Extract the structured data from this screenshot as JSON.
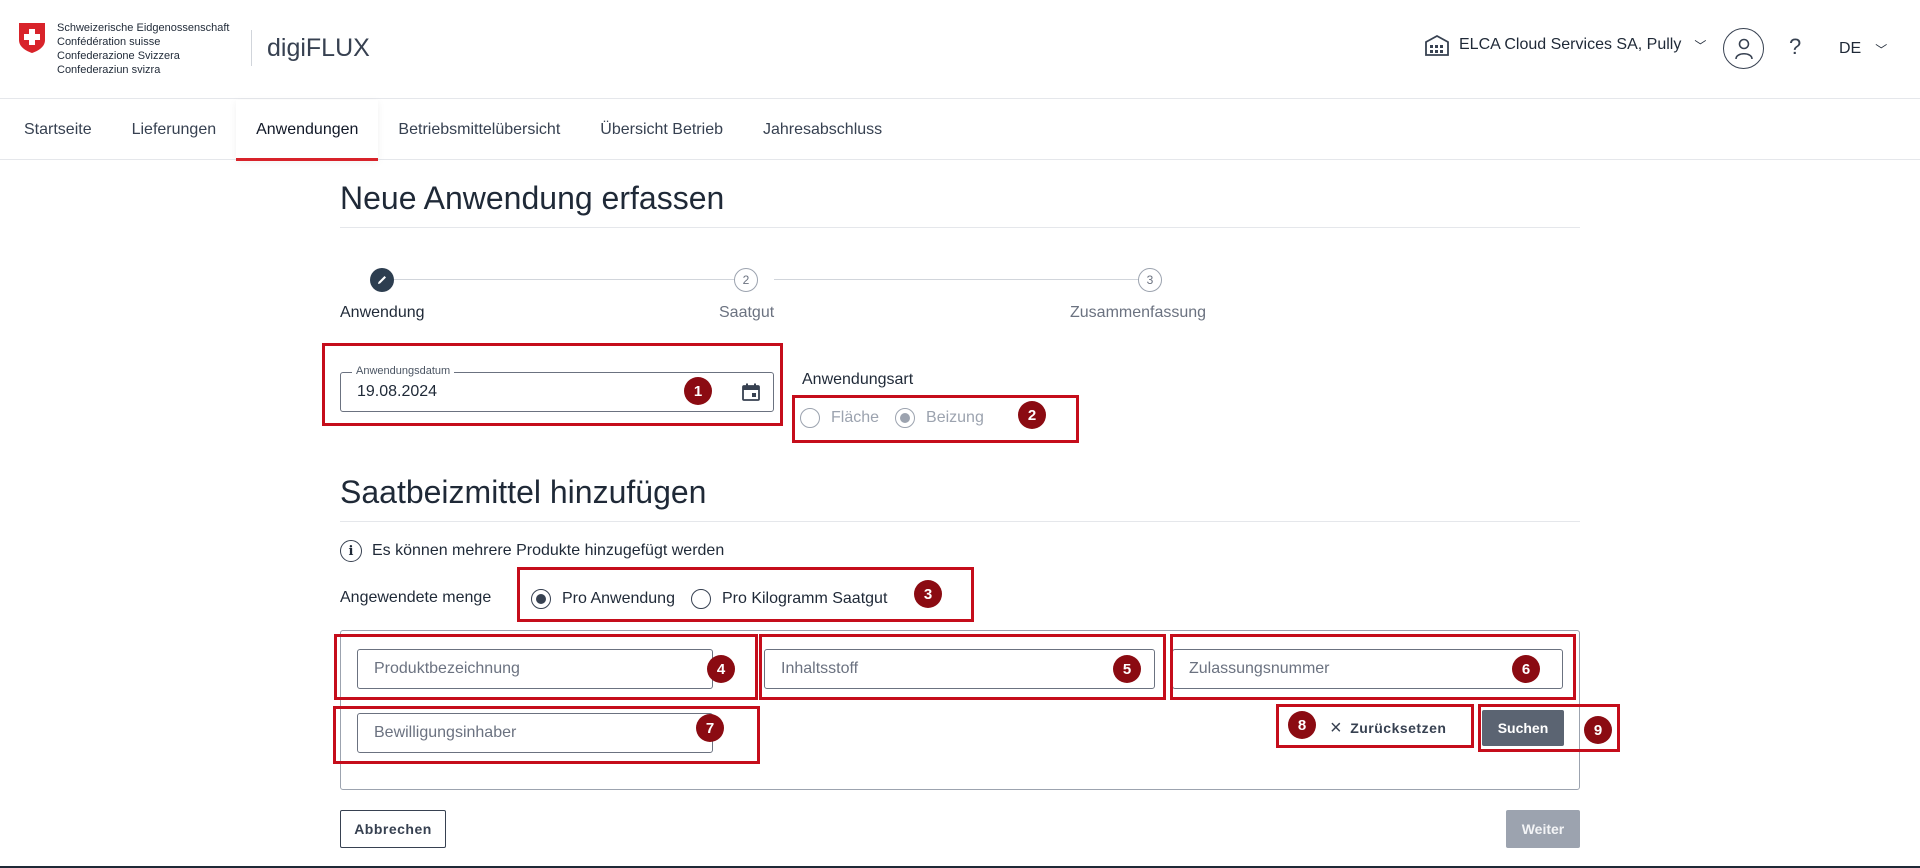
{
  "header": {
    "confederation_lines": [
      "Schweizerische Eidgenossenschaft",
      "Confédération suisse",
      "Confederazione Svizzera",
      "Confederaziun svizra"
    ],
    "app_name": "digiFLUX",
    "organization": "ELCA Cloud Services SA, Pully",
    "help_label": "?",
    "language": "DE",
    "chevron": "﹀"
  },
  "nav": {
    "items": [
      {
        "label": "Startseite",
        "active": false
      },
      {
        "label": "Lieferungen",
        "active": false
      },
      {
        "label": "Anwendungen",
        "active": true
      },
      {
        "label": "Betriebsmittelübersicht",
        "active": false
      },
      {
        "label": "Übersicht Betrieb",
        "active": false
      },
      {
        "label": "Jahresabschluss",
        "active": false
      }
    ]
  },
  "page": {
    "title": "Neue Anwendung erfassen",
    "stepper": {
      "steps": [
        {
          "number": "1",
          "label": "Anwendung",
          "state": "current"
        },
        {
          "number": "2",
          "label": "Saatgut",
          "state": "upcoming"
        },
        {
          "number": "3",
          "label": "Zusammenfassung",
          "state": "upcoming"
        }
      ]
    },
    "date_field": {
      "label": "Anwendungsdatum",
      "value": "19.08.2024"
    },
    "application_type": {
      "label": "Anwendungsart",
      "options": [
        {
          "label": "Fläche",
          "checked": false,
          "disabled": true
        },
        {
          "label": "Beizung",
          "checked": true,
          "disabled": true
        }
      ]
    },
    "section_title": "Saatbeizmittel hinzufügen",
    "info_text": "Es können mehrere Produkte hinzugefügt werden",
    "info_icon": "i",
    "amount": {
      "label": "Angewendete menge",
      "options": [
        {
          "label": "Pro Anwendung",
          "checked": true
        },
        {
          "label": "Pro Kilogramm Saatgut",
          "checked": false
        }
      ]
    },
    "search": {
      "product_placeholder": "Produktbezeichnung",
      "substance_placeholder": "Inhaltsstoff",
      "approval_placeholder": "Zulassungsnummer",
      "holder_placeholder": "Bewilligungsinhaber",
      "reset_label": "Zurücksetzen",
      "reset_icon": "×",
      "search_label": "Suchen"
    },
    "cancel_label": "Abbrechen",
    "next_label": "Weiter"
  },
  "annotations": [
    "1",
    "2",
    "3",
    "4",
    "5",
    "6",
    "7",
    "8",
    "9"
  ],
  "colors": {
    "accent_red": "#d8232a",
    "annotation_red": "#c50d1b",
    "badge_red": "#8b0b12",
    "search_button": "#5b6472",
    "disabled_button": "#9ca3af"
  }
}
